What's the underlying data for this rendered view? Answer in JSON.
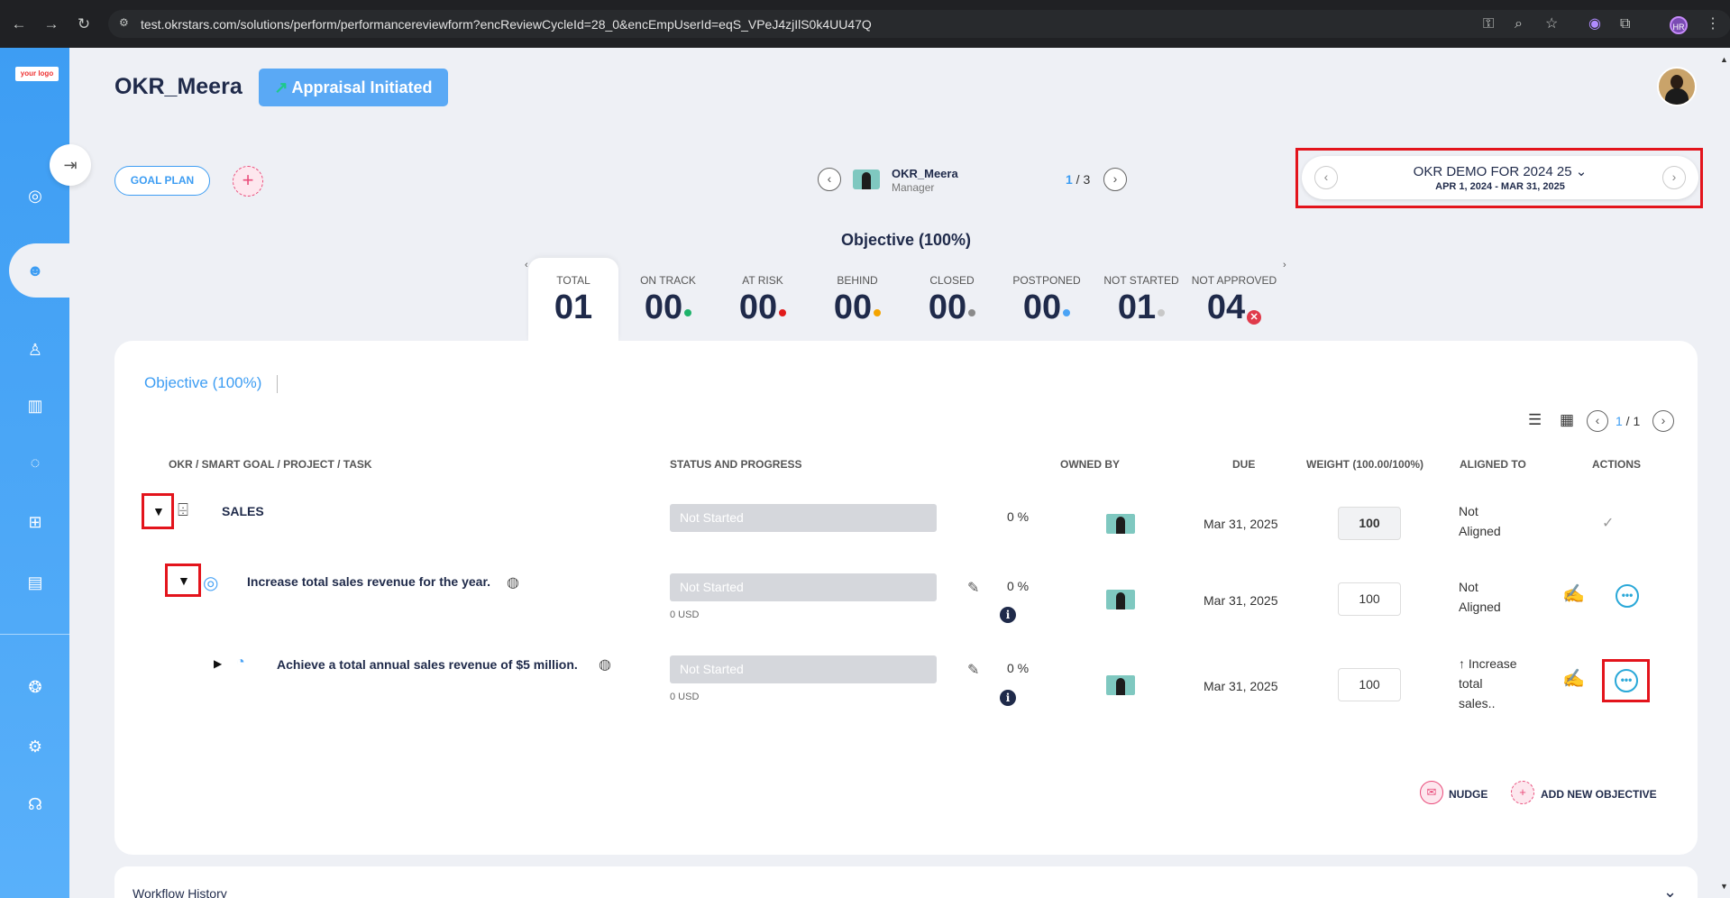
{
  "browser": {
    "url": "test.okrstars.com/solutions/perform/performancereviewform?encReviewCycleId=28_0&encEmpUserId=eqS_VPeJ4zjIlS0k4UU47Q",
    "profile_initials": "HR"
  },
  "sidebar": {
    "logo_text": "your logo",
    "items": [
      {
        "icon": "target-icon"
      },
      {
        "icon": "team-icon",
        "active": true
      },
      {
        "icon": "person-score-icon"
      },
      {
        "icon": "book-icon"
      },
      {
        "icon": "feedback-360-icon"
      },
      {
        "icon": "org-tree-icon"
      },
      {
        "icon": "report-icon"
      },
      {
        "icon": "brain-icon"
      },
      {
        "icon": "settings-icon"
      },
      {
        "icon": "support-icon"
      }
    ]
  },
  "header": {
    "title": "OKR_Meera",
    "status_button": "Appraisal Initiated"
  },
  "toolbar": {
    "goal_plan_label": "GOAL PLAN",
    "add_label": "+"
  },
  "employee": {
    "name": "OKR_Meera",
    "role": "Manager",
    "page_current": "1",
    "page_sep": " / ",
    "page_total": "3"
  },
  "cycle": {
    "name": "OKR DEMO FOR 2024 25",
    "dates": "APR 1, 2024 - MAR 31, 2025"
  },
  "objective_heading": "Objective (100%)",
  "stats": [
    {
      "label": "TOTAL",
      "value": "01",
      "dot": null
    },
    {
      "label": "ON TRACK",
      "value": "00",
      "dot": "#1fb36b"
    },
    {
      "label": "AT RISK",
      "value": "00",
      "dot": "#e11b1b"
    },
    {
      "label": "BEHIND",
      "value": "00",
      "dot": "#f4a400"
    },
    {
      "label": "CLOSED",
      "value": "00",
      "dot": "#8a8a8a"
    },
    {
      "label": "POSTPONED",
      "value": "00",
      "dot": "#4aa3f5"
    },
    {
      "label": "NOT STARTED",
      "value": "01",
      "dot": "#c8c8c8"
    },
    {
      "label": "NOT APPROVED",
      "value": "04",
      "dot": "x"
    }
  ],
  "card": {
    "tab_label": "Objective (100%)",
    "pager_current": "1",
    "pager_sep": " / ",
    "pager_total": "1",
    "columns": {
      "okr": "OKR / SMART GOAL / PROJECT / TASK",
      "status": "STATUS AND PROGRESS",
      "owned": "OWNED BY",
      "due": "DUE",
      "weight": "WEIGHT (100.00/100%)",
      "aligned": "ALIGNED TO",
      "actions": "ACTIONS"
    },
    "rows": [
      {
        "name": "SALES",
        "status": "Not Started",
        "progress_pct": "0  %",
        "usd": "",
        "due": "Mar 31, 2025",
        "weight": "100",
        "aligned_line1": "Not",
        "aligned_line2": "Aligned",
        "aligned_line3": ""
      },
      {
        "name": "Increase total sales revenue for the year.",
        "status": "Not Started",
        "progress_pct": "0  %",
        "usd": "0 USD",
        "due": "Mar 31, 2025",
        "weight": "100",
        "aligned_line1": "Not",
        "aligned_line2": "Aligned",
        "aligned_line3": ""
      },
      {
        "name": "Achieve a total annual sales revenue of $5 million.",
        "status": "Not Started",
        "progress_pct": "0  %",
        "usd": "0 USD",
        "due": "Mar 31, 2025",
        "weight": "100",
        "aligned_line1": "↑ Increase",
        "aligned_line2": "total",
        "aligned_line3": "sales.."
      }
    ],
    "nudge_label": "NUDGE",
    "add_objective_label": "ADD NEW OBJECTIVE"
  },
  "workflow": {
    "title": "Workflow History"
  },
  "colors": {
    "accent": "#3d9df3",
    "highlight_box": "#e3141c",
    "status_button": "#5aa9f5"
  }
}
